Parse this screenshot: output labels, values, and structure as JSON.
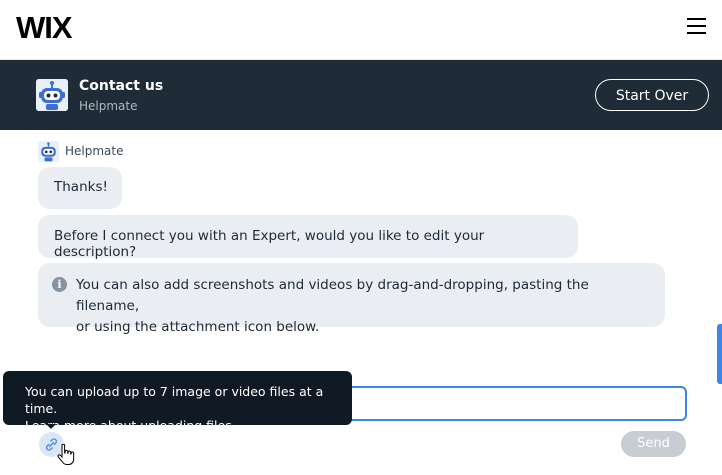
{
  "site": {
    "logo": "WIX"
  },
  "chat": {
    "title": "Contact us",
    "subtitle": "Helpmate",
    "start_over_label": "Start Over"
  },
  "messages": {
    "sender": "Helpmate",
    "thanks": "Thanks!",
    "question": "Before I connect you with an Expert, would you like to edit your description?",
    "info_line1": "You can also add screenshots and videos by drag-and-dropping, pasting the filename,",
    "info_line2": "or using the attachment icon below."
  },
  "composer": {
    "input_value": "",
    "send_label": "Send"
  },
  "tooltip": {
    "text": "You can upload up to 7 image or video files at a time.",
    "link": "Learn more about uploading files"
  },
  "colors": {
    "header_bg": "#1f2b36",
    "bubble_bg": "#eaedf2",
    "accent": "#3a87e8",
    "tooltip_bg": "#101a24",
    "send_disabled": "#c8cdd3"
  },
  "icons": [
    "menu-icon",
    "helpmate-robot-icon",
    "info-icon",
    "attachment-icon",
    "hand-cursor-icon"
  ]
}
